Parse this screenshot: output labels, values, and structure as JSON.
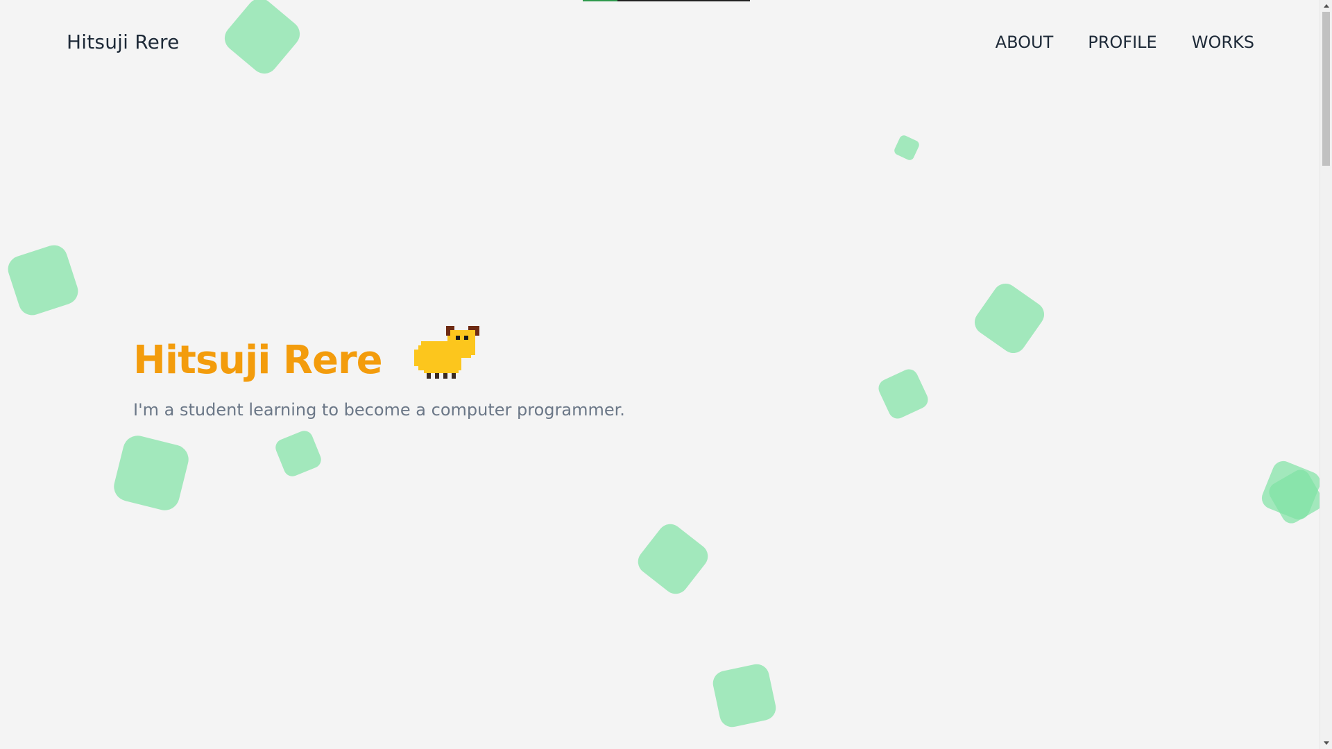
{
  "header": {
    "brand": "Hitsuji Rere",
    "nav": [
      {
        "label": "ABOUT"
      },
      {
        "label": "PROFILE"
      },
      {
        "label": "WORKS"
      }
    ]
  },
  "hero": {
    "title": "Hitsuji Rere",
    "subtitle": "I'm a student learning to become a computer programmer.",
    "mascot_icon": "pixel-sheep-icon"
  },
  "colors": {
    "background": "#f4f4f4",
    "accent": "#f39c0c",
    "text": "#1e2a38",
    "muted": "#6b7787",
    "shape": "#7fe3a4"
  }
}
